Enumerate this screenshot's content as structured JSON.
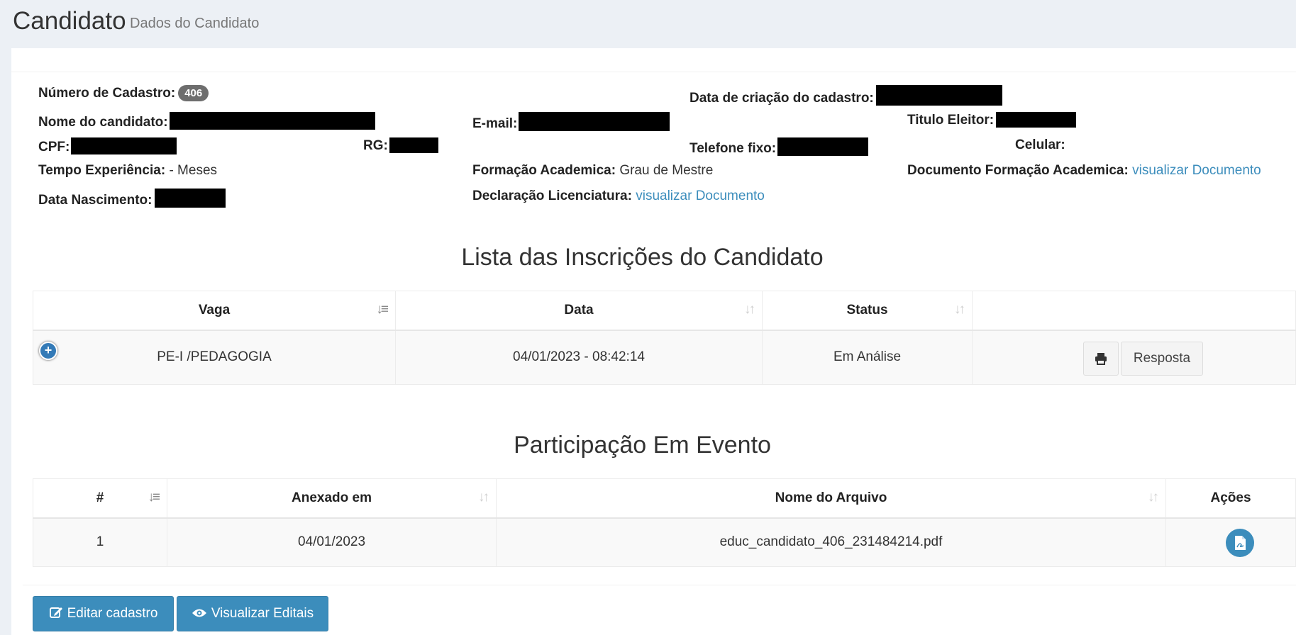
{
  "header": {
    "title": "Candidato",
    "subtitle": "Dados do Candidato"
  },
  "candidate": {
    "cadastro_label": "Número de Cadastro:",
    "cadastro_value": "406",
    "data_criacao_label": "Data de criação do cadastro:",
    "nome_label": "Nome do candidato:",
    "email_label": "E-mail:",
    "titulo_label": "Titulo Eleitor:",
    "cpf_label": "CPF:",
    "rg_label": "RG:",
    "telefone_label": "Telefone fixo:",
    "celular_label": "Celular:",
    "experiencia_label": "Tempo Experiência:",
    "experiencia_value": " - Meses",
    "formacao_label": "Formação Academica:",
    "formacao_value": "Grau de Mestre",
    "doc_formacao_label": "Documento Formação Academica:",
    "doc_formacao_link": "visualizar Documento",
    "nascimento_label": "Data Nascimento:",
    "licenciatura_label": "Declaração Licenciatura:",
    "licenciatura_link": "visualizar Documento"
  },
  "inscricoes": {
    "title": "Lista das Inscrições do Candidato",
    "columns": [
      "Vaga",
      "Data",
      "Status"
    ],
    "rows": [
      {
        "vaga": "PE-I /PEDAGOGIA",
        "data": "04/01/2023 - 08:42:14",
        "status": "Em Análise",
        "action_label": "Resposta"
      }
    ]
  },
  "eventos": {
    "title": "Participação Em Evento",
    "columns": [
      "#",
      "Anexado em",
      "Nome do Arquivo",
      "Ações"
    ],
    "rows": [
      {
        "num": "1",
        "anexado": "04/01/2023",
        "arquivo": "educ_candidato_406_231484214.pdf"
      }
    ]
  },
  "buttons": {
    "editar": "Editar cadastro",
    "editais": "Visualizar Editais"
  },
  "colors": {
    "primary": "#3c8dbc",
    "background": "#ecf0f5",
    "badge": "#6e6e6e"
  }
}
